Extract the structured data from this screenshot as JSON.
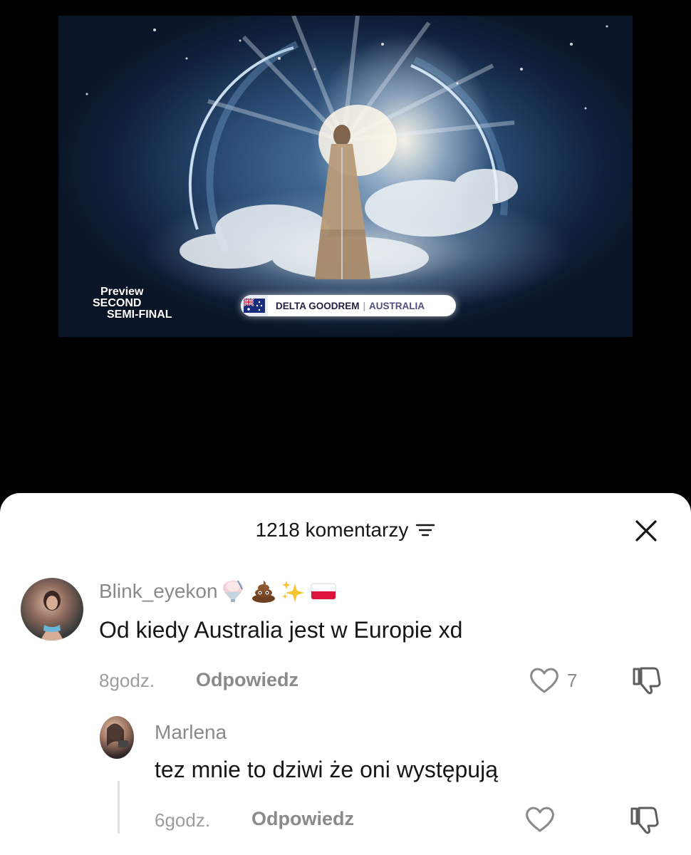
{
  "video": {
    "preview_line1": "Preview",
    "preview_line2": "SECOND",
    "preview_line3": "SEMI-FINAL",
    "artist": "DELTA GOODREM",
    "separator": "|",
    "country": "AUSTRALIA",
    "flag_icon": "australia-flag-icon"
  },
  "comments_panel": {
    "count_label": "1218 komentarzy",
    "sort_icon": "filter-sort-icon",
    "close_icon": "close-icon"
  },
  "comments": [
    {
      "username": "Blink_eyekon",
      "username_emojis": [
        "shaved-ice-emoji",
        "poop-emoji",
        "sparkles-emoji",
        "poland-flag-emoji"
      ],
      "text": "Od kiedy Australia jest w Europie xd",
      "time": "8godz.",
      "reply_label": "Odpowiedz",
      "likes": "7"
    }
  ],
  "replies": [
    {
      "username": "Marlena",
      "text": "tez mnie to dziwi że oni występują",
      "time": "6godz.",
      "reply_label": "Odpowiedz"
    }
  ],
  "colors": {
    "sheet_bg": "#ffffff",
    "text_primary": "#161616",
    "text_secondary": "#8a8a8a"
  }
}
